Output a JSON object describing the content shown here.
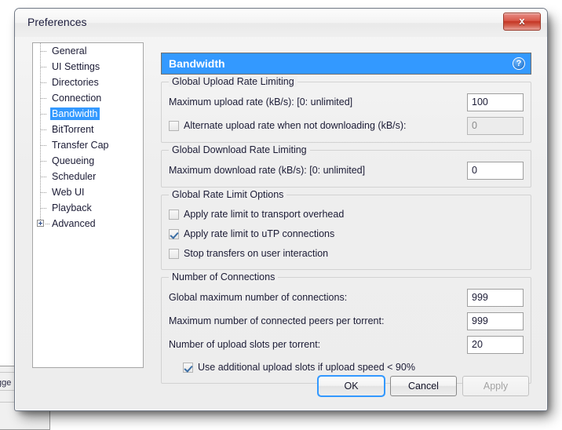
{
  "background": {
    "partial_tab_label": "gge",
    "note": ""
  },
  "window": {
    "title": "Preferences",
    "close_label": "x",
    "close_icon": "close-icon"
  },
  "sidebar": {
    "items": [
      {
        "label": "General",
        "selected": false,
        "expandable": false
      },
      {
        "label": "UI Settings",
        "selected": false,
        "expandable": false
      },
      {
        "label": "Directories",
        "selected": false,
        "expandable": false
      },
      {
        "label": "Connection",
        "selected": false,
        "expandable": false
      },
      {
        "label": "Bandwidth",
        "selected": true,
        "expandable": false
      },
      {
        "label": "BitTorrent",
        "selected": false,
        "expandable": false
      },
      {
        "label": "Transfer Cap",
        "selected": false,
        "expandable": false
      },
      {
        "label": "Queueing",
        "selected": false,
        "expandable": false
      },
      {
        "label": "Scheduler",
        "selected": false,
        "expandable": false
      },
      {
        "label": "Web UI",
        "selected": false,
        "expandable": false
      },
      {
        "label": "Playback",
        "selected": false,
        "expandable": false
      },
      {
        "label": "Advanced",
        "selected": false,
        "expandable": true
      }
    ]
  },
  "panel": {
    "title": "Bandwidth",
    "help_icon": "?",
    "accent_color": "#3399ff",
    "groups": [
      {
        "title": "Global Upload Rate Limiting",
        "rows": [
          {
            "kind": "field",
            "label": "Maximum upload rate (kB/s): [0: unlimited]",
            "value": "100",
            "disabled": false
          },
          {
            "kind": "check_field",
            "label": "Alternate upload rate when not downloading (kB/s):",
            "checked": false,
            "value": "0",
            "disabled": true
          }
        ]
      },
      {
        "title": "Global Download Rate Limiting",
        "rows": [
          {
            "kind": "field",
            "label": "Maximum download rate (kB/s): [0: unlimited]",
            "value": "0",
            "disabled": false
          }
        ]
      },
      {
        "title": "Global Rate Limit Options",
        "rows": [
          {
            "kind": "check",
            "label": "Apply rate limit to transport overhead",
            "checked": false
          },
          {
            "kind": "check",
            "label": "Apply rate limit to uTP connections",
            "checked": true
          },
          {
            "kind": "check",
            "label": "Stop transfers on user interaction",
            "checked": false
          }
        ]
      },
      {
        "title": "Number of Connections",
        "rows": [
          {
            "kind": "field",
            "label": "Global maximum number of connections:",
            "value": "999",
            "disabled": false
          },
          {
            "kind": "field",
            "label": "Maximum number of connected peers per torrent:",
            "value": "999",
            "disabled": false
          },
          {
            "kind": "field",
            "label": "Number of upload slots per torrent:",
            "value": "20",
            "disabled": false
          },
          {
            "kind": "check",
            "label": "Use additional upload slots if upload speed < 90%",
            "checked": true,
            "indent": true
          }
        ]
      }
    ]
  },
  "footer": {
    "ok_label": "OK",
    "cancel_label": "Cancel",
    "apply_label": "Apply",
    "apply_disabled": true,
    "ok_is_default": true
  }
}
